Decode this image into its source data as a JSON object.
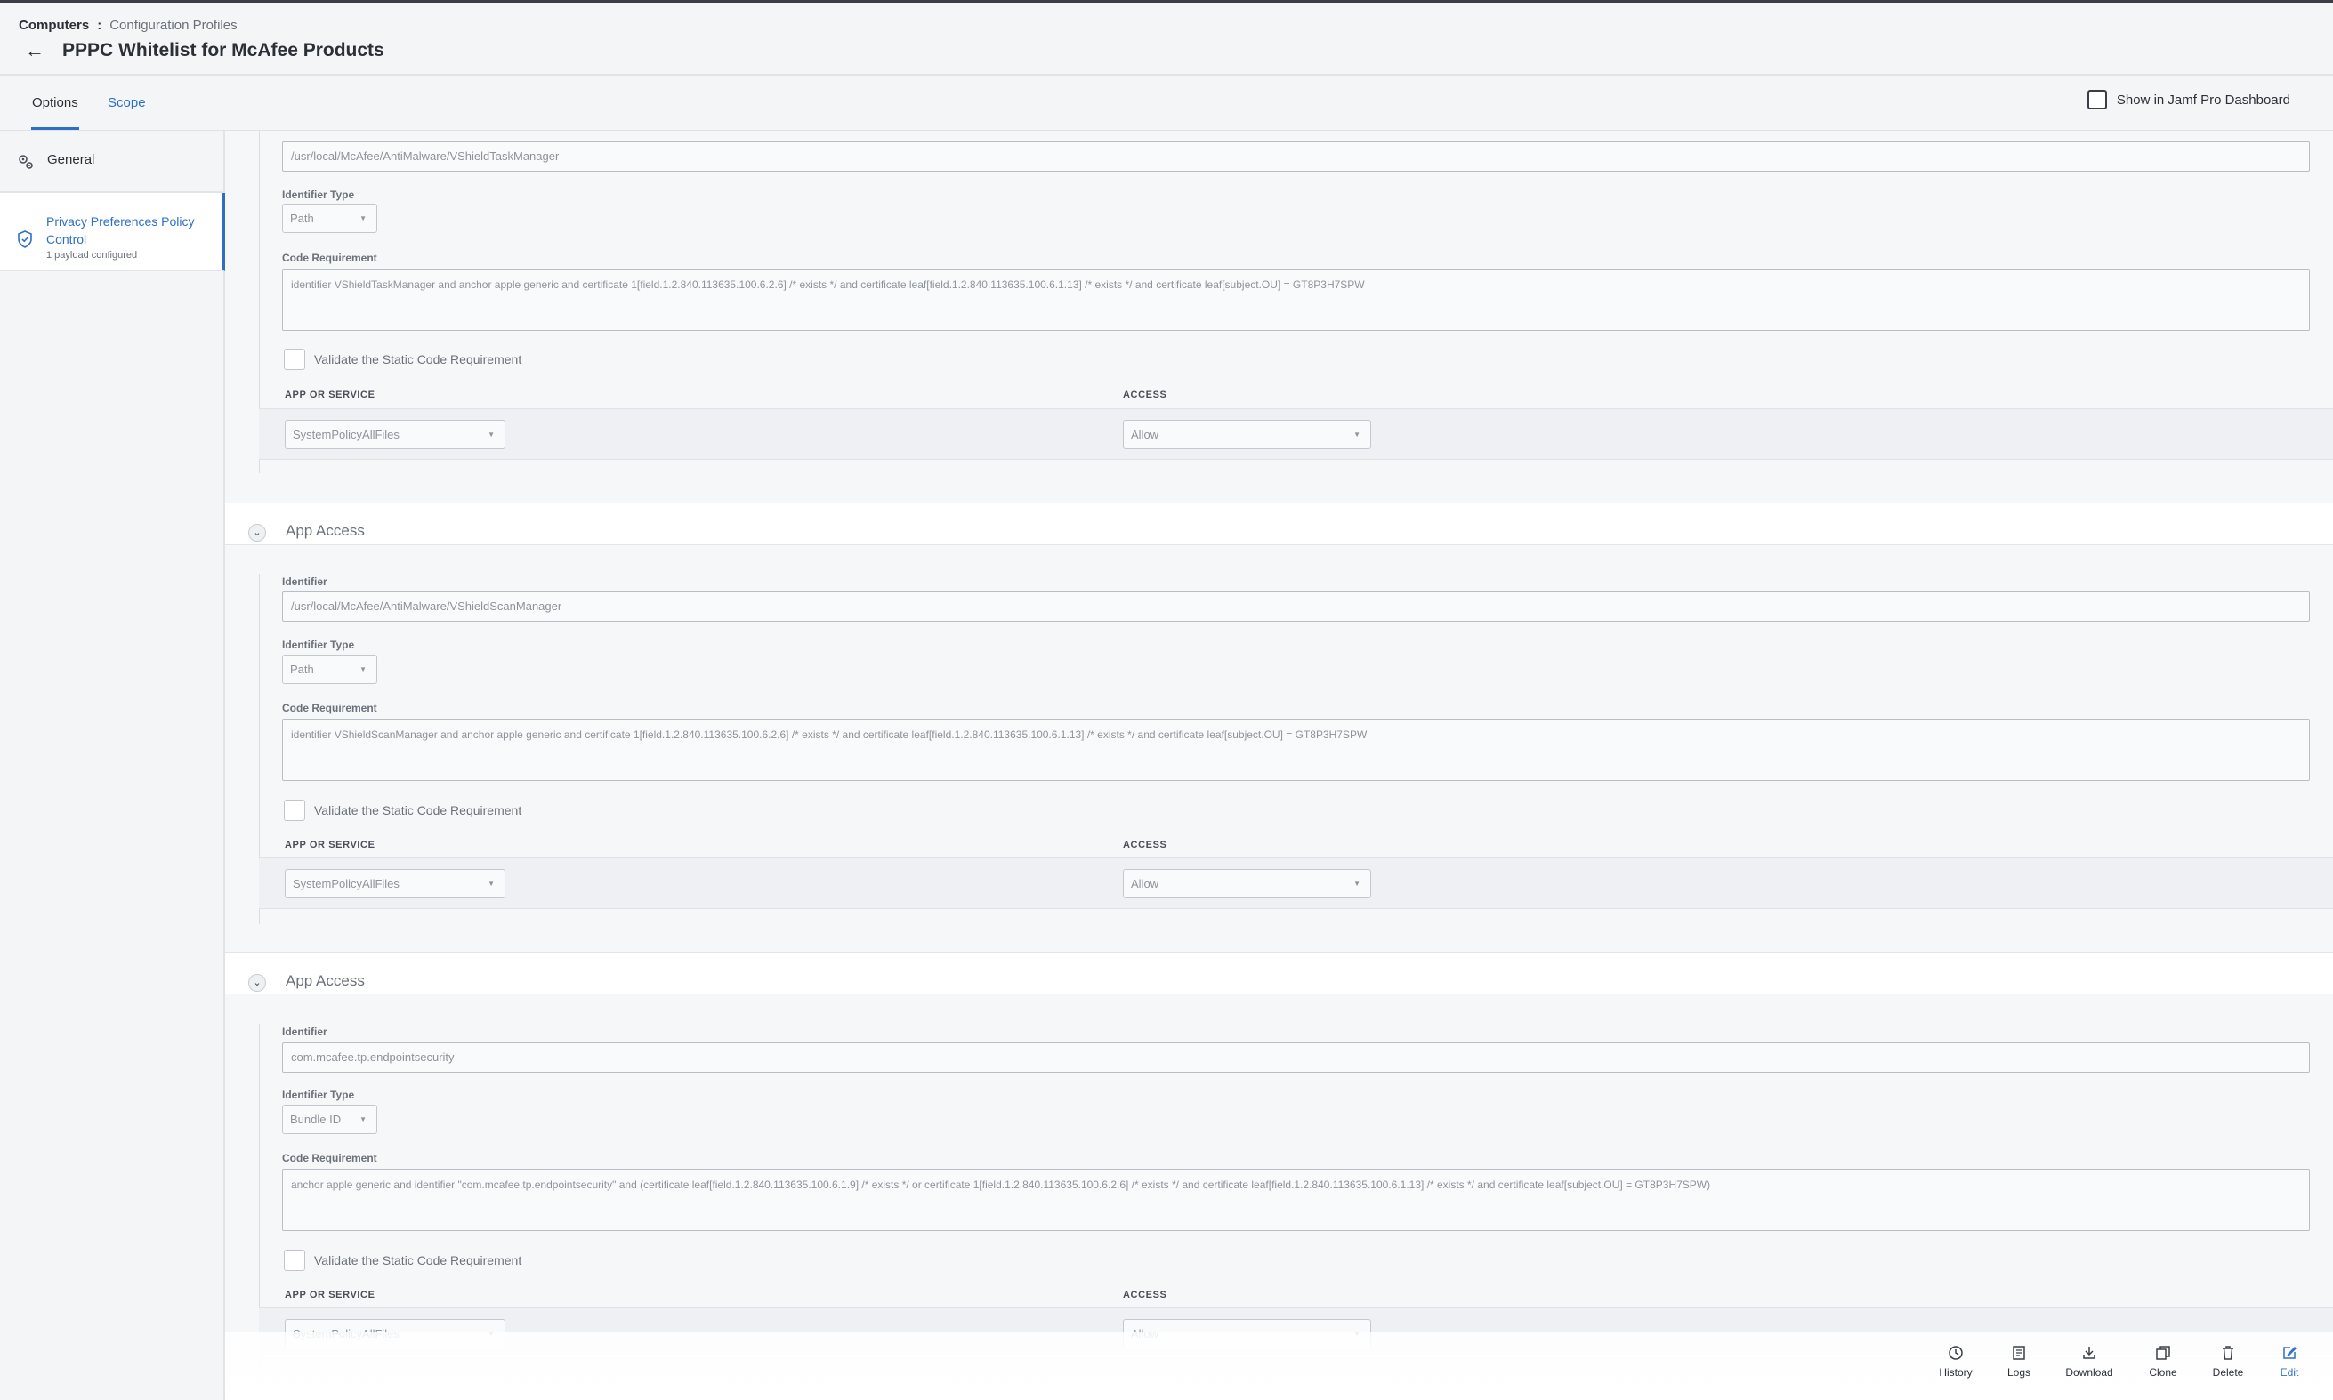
{
  "breadcrumb": {
    "root": "Computers",
    "separator": ":",
    "current": "Configuration Profiles"
  },
  "page": {
    "title": "PPPC Whitelist for McAfee Products"
  },
  "tabs": {
    "options": "Options",
    "scope": "Scope"
  },
  "dashboard": {
    "label": "Show in Jamf Pro Dashboard"
  },
  "sidebar": {
    "general": {
      "label": "General"
    },
    "pppc": {
      "label": "Privacy Preferences Policy Control",
      "sub": "1 payload configured"
    }
  },
  "labels": {
    "identifier": "Identifier",
    "identifier_type": "Identifier Type",
    "code_requirement": "Code Requirement",
    "validate": "Validate the Static Code Requirement",
    "app_or_service": "APP OR SERVICE",
    "access": "ACCESS",
    "section_title": "App Access"
  },
  "entries": [
    {
      "identifier": "/usr/local/McAfee/AntiMalware/VShieldTaskManager",
      "identifier_type": "Path",
      "code_requirement": "identifier VShieldTaskManager and anchor apple generic and certificate 1[field.1.2.840.113635.100.6.2.6] /* exists */ and certificate leaf[field.1.2.840.113635.100.6.1.13] /* exists */ and certificate leaf[subject.OU] = GT8P3H7SPW",
      "service": "SystemPolicyAllFiles",
      "access": "Allow"
    },
    {
      "identifier": "/usr/local/McAfee/AntiMalware/VShieldScanManager",
      "identifier_type": "Path",
      "code_requirement": "identifier VShieldScanManager and anchor apple generic and certificate 1[field.1.2.840.113635.100.6.2.6] /* exists */ and certificate leaf[field.1.2.840.113635.100.6.1.13] /* exists */ and certificate leaf[subject.OU] = GT8P3H7SPW",
      "service": "SystemPolicyAllFiles",
      "access": "Allow"
    },
    {
      "identifier": "com.mcafee.tp.endpointsecurity",
      "identifier_type": "Bundle ID",
      "code_requirement": "anchor apple generic and identifier \"com.mcafee.tp.endpointsecurity\" and (certificate leaf[field.1.2.840.113635.100.6.1.9] /* exists */ or certificate 1[field.1.2.840.113635.100.6.2.6] /* exists */ and certificate leaf[field.1.2.840.113635.100.6.1.13] /* exists */ and certificate leaf[subject.OU] = GT8P3H7SPW)",
      "service": "SystemPolicyAllFiles",
      "access": "Allow"
    }
  ],
  "actions": {
    "history": "History",
    "logs": "Logs",
    "download": "Download",
    "clone": "Clone",
    "delete": "Delete",
    "edit": "Edit"
  },
  "colors": {
    "accent": "#2e6fc6",
    "header_bg": "#f4f5f7",
    "panel_bg": "#f6f7f9"
  }
}
